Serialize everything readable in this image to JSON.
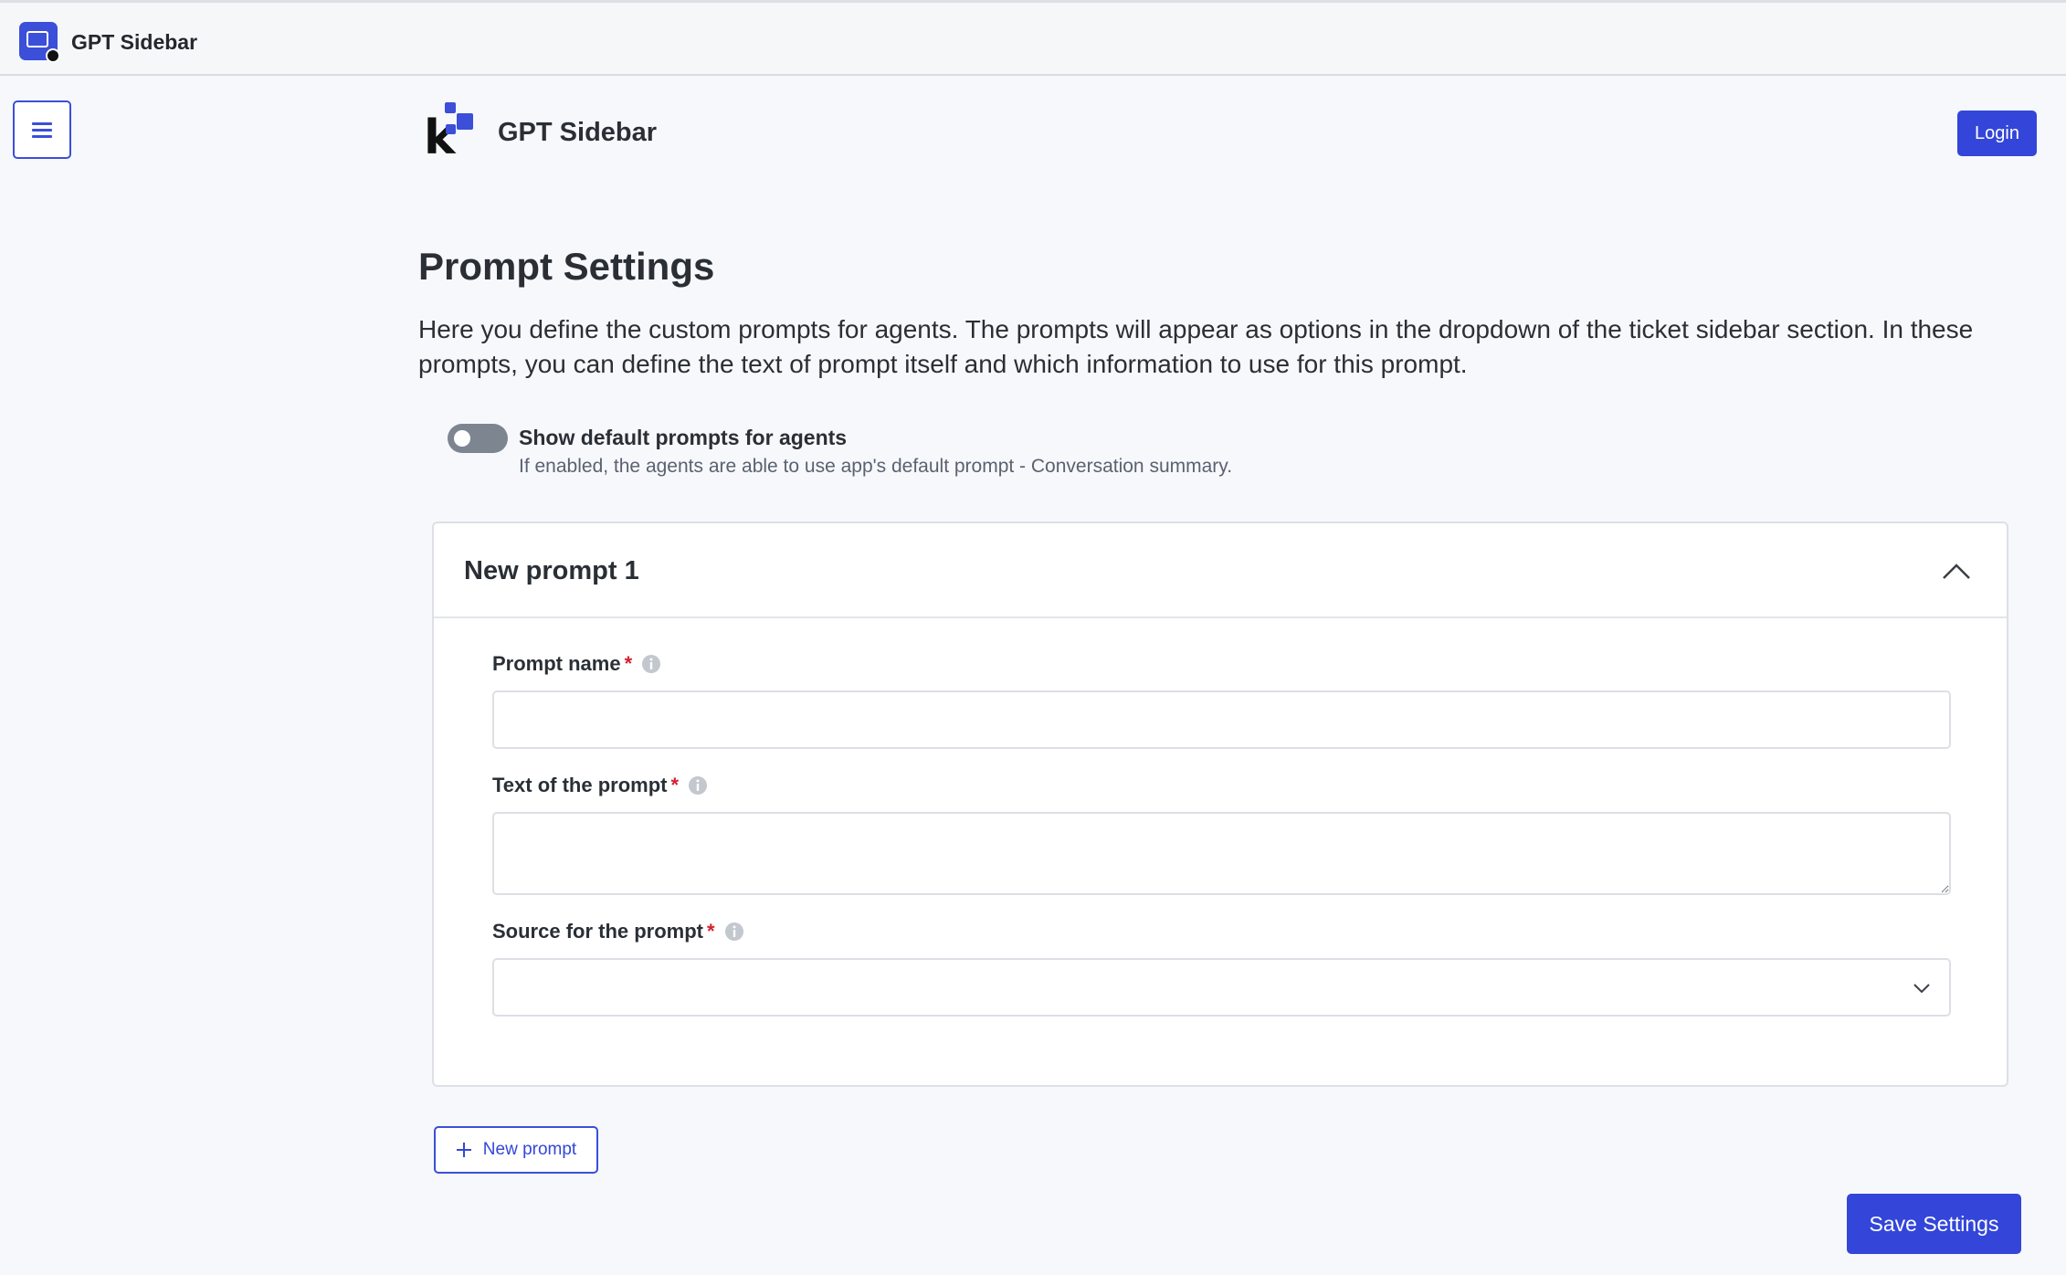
{
  "topbar": {
    "app_icon": "app-icon",
    "title": "GPT Sidebar"
  },
  "header": {
    "menu_icon": "hamburger-menu-icon",
    "brand_logo": "k-logo",
    "brand_title": "GPT Sidebar",
    "login_label": "Login"
  },
  "main": {
    "heading": "Prompt Settings",
    "description": "Here you define the custom prompts for agents. The prompts will appear as options in the dropdown of the ticket sidebar section. In these prompts, you can define the text of prompt itself and which information to use for this prompt.",
    "default_toggle": {
      "label": "Show default prompts for agents",
      "help": "If enabled, the agents are able to use app's default prompt - Conversation summary.",
      "enabled": false
    },
    "prompt_card": {
      "title": "New prompt 1",
      "collapse_icon": "chevron-up-icon",
      "fields": {
        "name": {
          "label": "Prompt name",
          "required_mark": "*",
          "value": "",
          "info_icon": "info-icon"
        },
        "text": {
          "label": "Text of the prompt",
          "required_mark": "*",
          "value": "",
          "info_icon": "info-icon"
        },
        "source": {
          "label": "Source for the prompt",
          "required_mark": "*",
          "value": "",
          "info_icon": "info-icon",
          "arrow_icon": "chevron-down-icon"
        }
      }
    },
    "new_prompt_label": "New prompt",
    "new_prompt_icon": "plus-icon",
    "save_label": "Save Settings"
  },
  "colors": {
    "accent": "#3346d9",
    "toggle_off": "#7d8590",
    "required": "#d4202f"
  }
}
